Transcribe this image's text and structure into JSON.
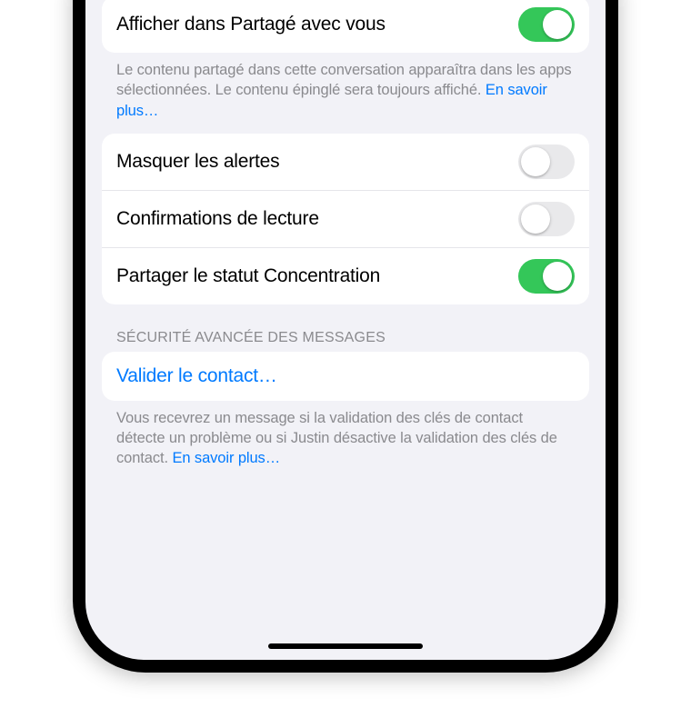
{
  "group1": {
    "row1": {
      "label": "Afficher dans Partagé avec vous",
      "on": true
    },
    "footer": "Le contenu partagé dans cette conversation apparaîtra dans les apps sélectionnées. Le contenu épinglé sera toujours affiché. ",
    "footer_link": "En savoir plus…"
  },
  "group2": {
    "row1": {
      "label": "Masquer les alertes",
      "on": false
    },
    "row2": {
      "label": "Confirmations de lecture",
      "on": false
    },
    "row3": {
      "label": "Partager le statut Concentration",
      "on": true
    }
  },
  "section3": {
    "header": "SÉCURITÉ AVANCÉE DES MESSAGES",
    "row1": {
      "label": "Valider le contact…"
    },
    "footer": "Vous recevrez un message si la validation des clés de contact détecte un problème ou si Justin désactive la validation des clés de contact. ",
    "footer_link": "En savoir plus…"
  }
}
